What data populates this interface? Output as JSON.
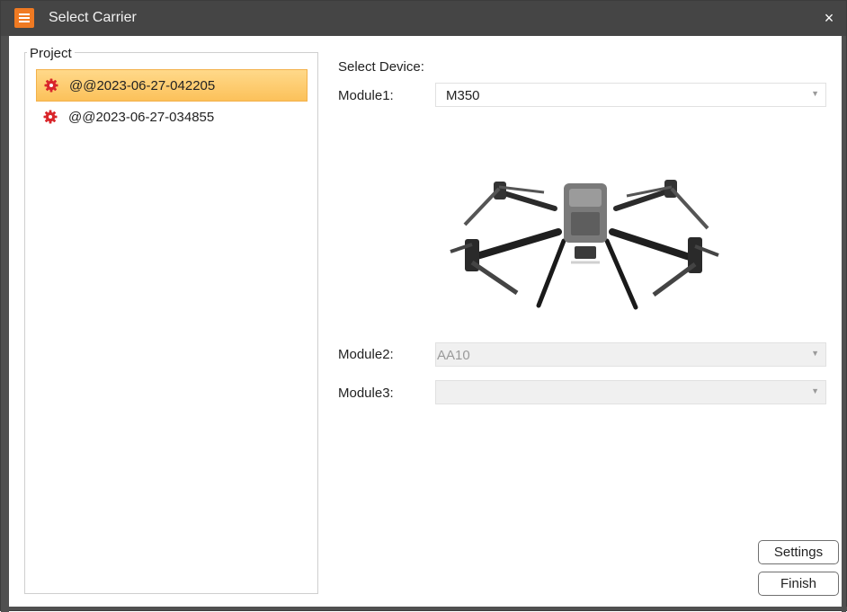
{
  "window": {
    "title": "Select Carrier"
  },
  "project": {
    "legend": "Project",
    "items": [
      {
        "label": "@@2023-06-27-042205",
        "selected": true
      },
      {
        "label": "@@2023-06-27-034855",
        "selected": false
      }
    ]
  },
  "device": {
    "heading": "Select Device:",
    "module1": {
      "label": "Module1:",
      "value": "M350"
    },
    "module2": {
      "label": "Module2:",
      "value": "AA10"
    },
    "module3": {
      "label": "Module3:",
      "value": ""
    }
  },
  "buttons": {
    "settings": "Settings",
    "finish": "Finish"
  },
  "colors": {
    "titlebar": "#454545",
    "accent": "#f07a22",
    "selection": "#fcc15a",
    "project_icon": "#d9262b"
  }
}
